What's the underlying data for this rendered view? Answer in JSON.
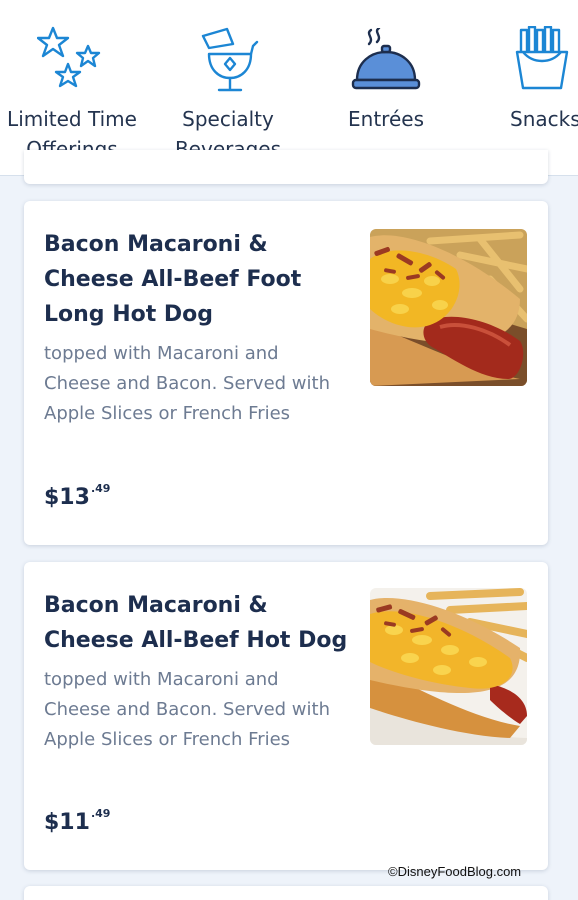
{
  "tabs": [
    {
      "label": "Limited Time\nOfferings",
      "icon": "stars-icon"
    },
    {
      "label": "Specialty\nBeverages",
      "icon": "cocktail-glass-icon"
    },
    {
      "label": "Entrées",
      "icon": "cloche-icon",
      "selected": true
    },
    {
      "label": "Snacks",
      "icon": "french-fries-icon"
    }
  ],
  "accent_color": "#1c86d4",
  "items": [
    {
      "title": "Bacon Macaroni & Cheese All-Beef Foot Long Hot Dog",
      "description": "topped with Macaroni and Cheese and Bacon. Served with Apple Slices or French Fries",
      "price_dollars": "$13",
      "price_cents": ".49"
    },
    {
      "title": "Bacon Macaroni & Cheese All-Beef Hot Dog",
      "description": "topped with Macaroni and Cheese and Bacon. Served with Apple Slices or French Fries",
      "price_dollars": "$11",
      "price_cents": ".49"
    }
  ],
  "watermark": "©DisneyFoodBlog.com"
}
